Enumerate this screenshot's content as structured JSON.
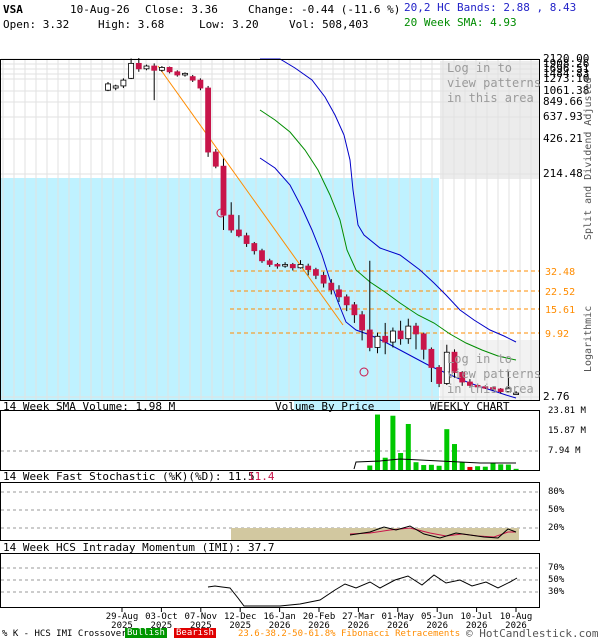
{
  "header": {
    "ticker": "VSA",
    "date": "10-Aug-26",
    "close": "Close: 3.36",
    "change": "Change: -0.44 (-11.6 %)",
    "open": "Open: 3.32",
    "high": "High: 3.68",
    "low": "Low: 3.20",
    "vol": "Vol: 508,403",
    "bands_label": "20,2 HC Bands: 2.88 , 8.43",
    "sma_label": "20 Week SMA: 4.93"
  },
  "colors": {
    "up": "#ffffff",
    "down": "#c8154a",
    "band": "#0000c8",
    "sma": "#008c00",
    "fib": "#ff8c00",
    "trend": "#ff8c00",
    "vbp": "#bff2ff",
    "volume": "#00c800",
    "volume_down": "#e00000"
  },
  "overlay": {
    "login_top": "Log in to\nview patterns\nin this area",
    "login_bottom": "Log in to\nview patterns\nin this area"
  },
  "side_labels": {
    "split": "Split and Dividend Adjusted",
    "log": "Logarithmic"
  },
  "panels": {
    "volume_title": "14 Week SMA Volume: 1.98 M",
    "vbp_title": "Volume By Price",
    "weekly": "WEEKLY CHART",
    "stoch_title": "14 Week Fast Stochastic (%K)(%D): 11.5",
    "stoch_d": "11.4",
    "imi_title": "14 Week HCS Intraday Momentum (IMI): 37.7",
    "volume_ticks": [
      "23.81 M",
      "15.87 M",
      "7.94 M"
    ],
    "stoch_ticks": [
      "80%",
      "50%",
      "20%"
    ],
    "imi_ticks": [
      "70%",
      "50%",
      "30%"
    ]
  },
  "footer": {
    "legend_prefix": "% K - HCS IMI Crossover:",
    "bullish": "Bullish",
    "bearish": "Bearish",
    "fib": "23.6-38.2-50-61.8% Fibonacci Retracements",
    "copyright": "© HotCandlestick.com"
  },
  "chart_data": {
    "type": "candlestick",
    "scale": "logarithmic",
    "y_ticks": [
      "2120.00",
      "1908.26",
      "1696.51",
      "1484.83",
      "1273.10",
      "1061.38",
      "849.66",
      "637.93",
      "426.21",
      "214.48",
      "2.76"
    ],
    "fib_levels": [
      "32.48",
      "22.52",
      "15.61",
      "9.92"
    ],
    "x_ticks": [
      {
        "m": "29-Aug",
        "y": "2025"
      },
      {
        "m": "03-Oct",
        "y": "2025"
      },
      {
        "m": "07-Nov",
        "y": "2025"
      },
      {
        "m": "12-Dec",
        "y": "2025"
      },
      {
        "m": "16-Jan",
        "y": "2026"
      },
      {
        "m": "20-Feb",
        "y": "2026"
      },
      {
        "m": "27-Mar",
        "y": "2026"
      },
      {
        "m": "01-May",
        "y": "2026"
      },
      {
        "m": "05-Jun",
        "y": "2026"
      },
      {
        "m": "10-Jul",
        "y": "2026"
      },
      {
        "m": "10-Aug",
        "y": "2026"
      }
    ],
    "candles": [
      [
        1100,
        1250,
        1080,
        1300
      ],
      [
        1150,
        1200,
        1100,
        1230
      ],
      [
        1200,
        1350,
        1150,
        1400
      ],
      [
        1400,
        1900,
        1380,
        2100
      ],
      [
        1900,
        1700,
        1600,
        2120
      ],
      [
        1700,
        1800,
        1650,
        1850
      ],
      [
        1800,
        1650,
        900,
        1900
      ],
      [
        1650,
        1750,
        1600,
        1800
      ],
      [
        1750,
        1600,
        1550,
        1780
      ],
      [
        1600,
        1500,
        1450,
        1650
      ],
      [
        1500,
        1550,
        1450,
        1580
      ],
      [
        1450,
        1350,
        1300,
        1500
      ],
      [
        1350,
        1150,
        1100,
        1400
      ],
      [
        1150,
        330,
        300,
        1200
      ],
      [
        330,
        250,
        240,
        350
      ],
      [
        250,
        140,
        120,
        290
      ],
      [
        140,
        120,
        110,
        160
      ],
      [
        120,
        100,
        95,
        140
      ],
      [
        100,
        78,
        70,
        110
      ],
      [
        78,
        62,
        55,
        82
      ],
      [
        62,
        45,
        42,
        66
      ],
      [
        45,
        40,
        37,
        48
      ],
      [
        40,
        38,
        35,
        42
      ],
      [
        38,
        40,
        36,
        43
      ],
      [
        40,
        36,
        33,
        42
      ],
      [
        36,
        40,
        35,
        46
      ],
      [
        38,
        34,
        30,
        41
      ],
      [
        34,
        30,
        28,
        36
      ],
      [
        30,
        26,
        24,
        32
      ],
      [
        26,
        23,
        21,
        28
      ],
      [
        23,
        20,
        18,
        25
      ],
      [
        20,
        17,
        15,
        21
      ],
      [
        17,
        14,
        12,
        18
      ],
      [
        14,
        10.5,
        9,
        15
      ],
      [
        10.5,
        8.2,
        7.8,
        45
      ],
      [
        8.2,
        9.5,
        7.6,
        10
      ],
      [
        9.5,
        8.8,
        7.5,
        12
      ],
      [
        8.8,
        10.3,
        8.2,
        11
      ],
      [
        10.3,
        9.2,
        8.5,
        12.5
      ],
      [
        9.2,
        11.3,
        8.6,
        13
      ],
      [
        11.3,
        9.8,
        8,
        12
      ],
      [
        9.8,
        8.0,
        7,
        10
      ],
      [
        8.0,
        6.3,
        5.2,
        8.2
      ],
      [
        6.3,
        5.1,
        4.5,
        6.5
      ],
      [
        5.1,
        7.7,
        5,
        8.5
      ],
      [
        7.7,
        5.9,
        5.5,
        8
      ],
      [
        5.9,
        5.2,
        4.8,
        6
      ],
      [
        5.2,
        4.9,
        4.4,
        5.4
      ],
      [
        4.9,
        4.6,
        4.2,
        5.1
      ],
      [
        4.6,
        4.4,
        4.1,
        4.9
      ],
      [
        4.4,
        4.1,
        3.8,
        4.6
      ],
      [
        4.1,
        3.6,
        3.3,
        4.3
      ],
      [
        3.6,
        4.3,
        3.5,
        6
      ],
      [
        3.32,
        3.36,
        3.2,
        3.68
      ]
    ],
    "volume": [
      0,
      0,
      0,
      0,
      0,
      0,
      0,
      0,
      0,
      0,
      0,
      0,
      0,
      0,
      0,
      0,
      0,
      0,
      0,
      0,
      0,
      0,
      0,
      0,
      0,
      0,
      0,
      0,
      0,
      0,
      0,
      0,
      0,
      0,
      1.9,
      23.5,
      5.2,
      23.0,
      7.2,
      19.5,
      3.3,
      2.1,
      2.2,
      1.8,
      17.3,
      11.0,
      3.2,
      1.3,
      1.6,
      1.4,
      3.0,
      2.4,
      2.3,
      0.5
    ]
  }
}
